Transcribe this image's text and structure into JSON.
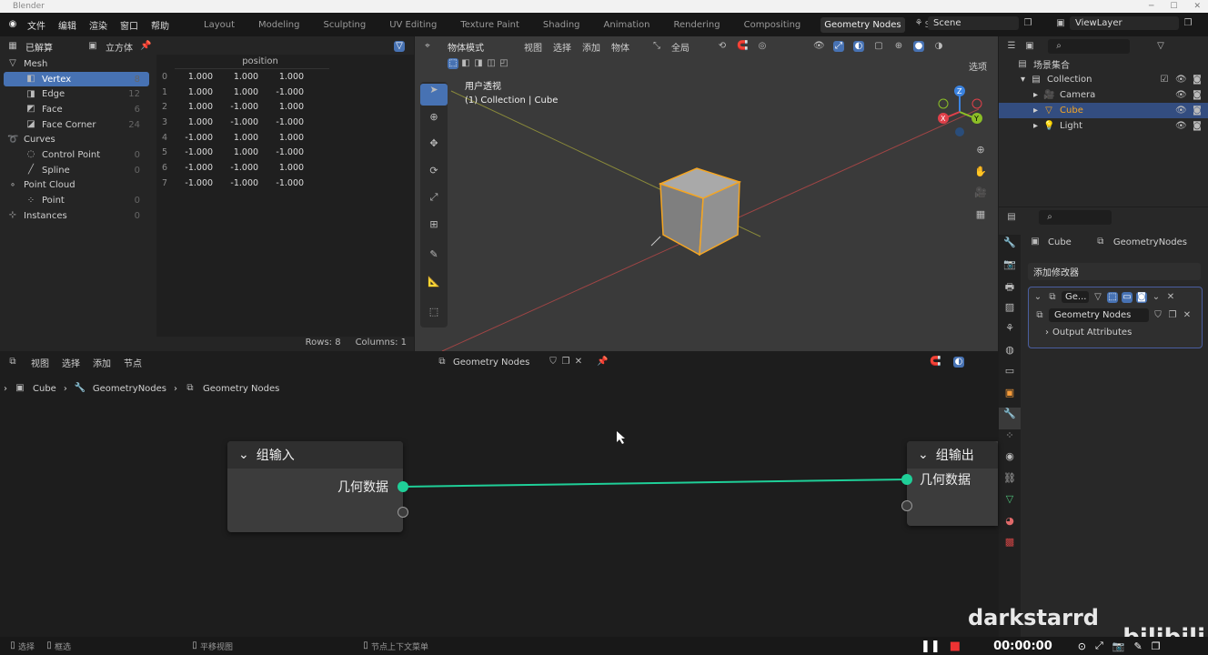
{
  "window": {
    "title": "Blender",
    "controls": [
      "─",
      "☐",
      "✕"
    ]
  },
  "topbar": {
    "menus": [
      "文件",
      "编辑",
      "渲染",
      "窗口",
      "帮助"
    ],
    "workspaces": [
      "Layout",
      "Modeling",
      "Sculpting",
      "UV Editing",
      "Texture Paint",
      "Shading",
      "Animation",
      "Rendering",
      "Compositing",
      "Geometry Nodes",
      "Scripting",
      "+"
    ],
    "active_workspace": "Geometry Nodes",
    "scene": "Scene",
    "view_layer": "ViewLayer"
  },
  "spreadsheet": {
    "mode": "已解算",
    "object": "立方体",
    "domains": [
      {
        "label": "Mesh",
        "count": "",
        "level": 0
      },
      {
        "label": "Vertex",
        "count": "8",
        "level": 1,
        "selected": true
      },
      {
        "label": "Edge",
        "count": "12",
        "level": 1
      },
      {
        "label": "Face",
        "count": "6",
        "level": 1
      },
      {
        "label": "Face Corner",
        "count": "24",
        "level": 1
      },
      {
        "label": "Curves",
        "count": "",
        "level": 0
      },
      {
        "label": "Control Point",
        "count": "0",
        "level": 1
      },
      {
        "label": "Spline",
        "count": "0",
        "level": 1
      },
      {
        "label": "Point Cloud",
        "count": "",
        "level": 0
      },
      {
        "label": "Point",
        "count": "0",
        "level": 1
      },
      {
        "label": "Instances",
        "count": "0",
        "level": 0
      }
    ],
    "column_header": "position",
    "rows": [
      [
        "0",
        "1.000",
        "1.000",
        "1.000"
      ],
      [
        "1",
        "1.000",
        "1.000",
        "-1.000"
      ],
      [
        "2",
        "1.000",
        "-1.000",
        "1.000"
      ],
      [
        "3",
        "1.000",
        "-1.000",
        "-1.000"
      ],
      [
        "4",
        "-1.000",
        "1.000",
        "1.000"
      ],
      [
        "5",
        "-1.000",
        "1.000",
        "-1.000"
      ],
      [
        "6",
        "-1.000",
        "-1.000",
        "1.000"
      ],
      [
        "7",
        "-1.000",
        "-1.000",
        "-1.000"
      ]
    ],
    "footer": {
      "rows": "Rows: 8",
      "columns": "Columns: 1"
    }
  },
  "viewport": {
    "mode": "物体模式",
    "menus": [
      "视图",
      "选择",
      "添加",
      "物体"
    ],
    "transform": "全局",
    "options": "选项",
    "view_name": "用户透视",
    "collection_info": "(1) Collection | Cube",
    "gizmo": {
      "z": "Z",
      "y": "Y",
      "x": "X"
    },
    "accent": "#4772b3",
    "selection_color": "#f5a623"
  },
  "outliner": {
    "root": "场景集合",
    "items": [
      {
        "label": "Collection",
        "level": 0
      },
      {
        "label": "Camera",
        "level": 1
      },
      {
        "label": "Cube",
        "level": 1,
        "selected": true
      },
      {
        "label": "Light",
        "level": 1
      }
    ]
  },
  "properties": {
    "object": "Cube",
    "modifier_name": "GeometryNodes",
    "add_modifier": "添加修改器",
    "modifier_short": "Ge...",
    "node_group": "Geometry Nodes",
    "output_attributes": "Output Attributes"
  },
  "node_editor": {
    "menus": [
      "视图",
      "选择",
      "添加",
      "节点"
    ],
    "node_group": "Geometry Nodes",
    "breadcrumb": [
      "Cube",
      "GeometryNodes",
      "Geometry Nodes"
    ],
    "nodes": {
      "input": {
        "title": "组输入",
        "socket": "几何数据"
      },
      "output": {
        "title": "组输出",
        "socket": "几何数据"
      }
    },
    "link_color": "#1fcf98"
  },
  "statusbar": {
    "items": [
      "选择",
      "框选",
      "平移视图",
      "节点上下文菜单"
    ]
  },
  "overlay": {
    "watermark": "darkstarrd",
    "brand": "bilibili",
    "timer": "00:00:00"
  }
}
